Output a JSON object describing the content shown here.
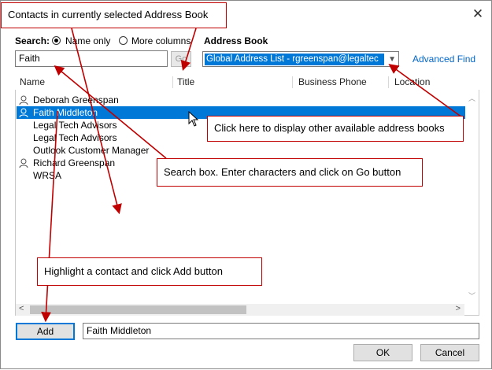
{
  "dialog": {
    "close_glyph": "✕"
  },
  "search": {
    "label": "Search:",
    "name_only_label": "Name only",
    "more_columns_label": "More columns",
    "name_only_checked": true,
    "query": "Faith",
    "go_label": "Go"
  },
  "address_book": {
    "label": "Address Book",
    "selected": "Global Address List - rgreenspan@legaltec",
    "advanced_find_label": "Advanced Find"
  },
  "list": {
    "columns": [
      "Name",
      "Title",
      "Business Phone",
      "Location"
    ],
    "rows": [
      {
        "name": "Deborah Greenspan",
        "icon": "person-icon",
        "selected": false
      },
      {
        "name": "Faith Middleton",
        "icon": "person-icon",
        "selected": true
      },
      {
        "name": "Legal Tech Advisors",
        "icon": "",
        "selected": false
      },
      {
        "name": "Legal Tech Advisors",
        "icon": "",
        "selected": false
      },
      {
        "name": "Outlook Customer Manager",
        "icon": "",
        "selected": false
      },
      {
        "name": "Richard Greenspan",
        "icon": "person-icon",
        "selected": true
      },
      {
        "name": "WRSA",
        "icon": "",
        "selected": false
      }
    ]
  },
  "footer": {
    "add_label": "Add",
    "added_value": "Faith Middleton",
    "ok_label": "OK",
    "cancel_label": "Cancel"
  },
  "annotations": {
    "top_callout": "Contacts in currently selected Address Book",
    "address_book_callout": "Click here to display other available address books",
    "search_callout": "Search box.  Enter characters and click on Go button",
    "add_callout": "Highlight a contact and click Add button",
    "color": "#c00000"
  },
  "colors": {
    "selection": "#0078d7",
    "link": "#0066cc"
  }
}
